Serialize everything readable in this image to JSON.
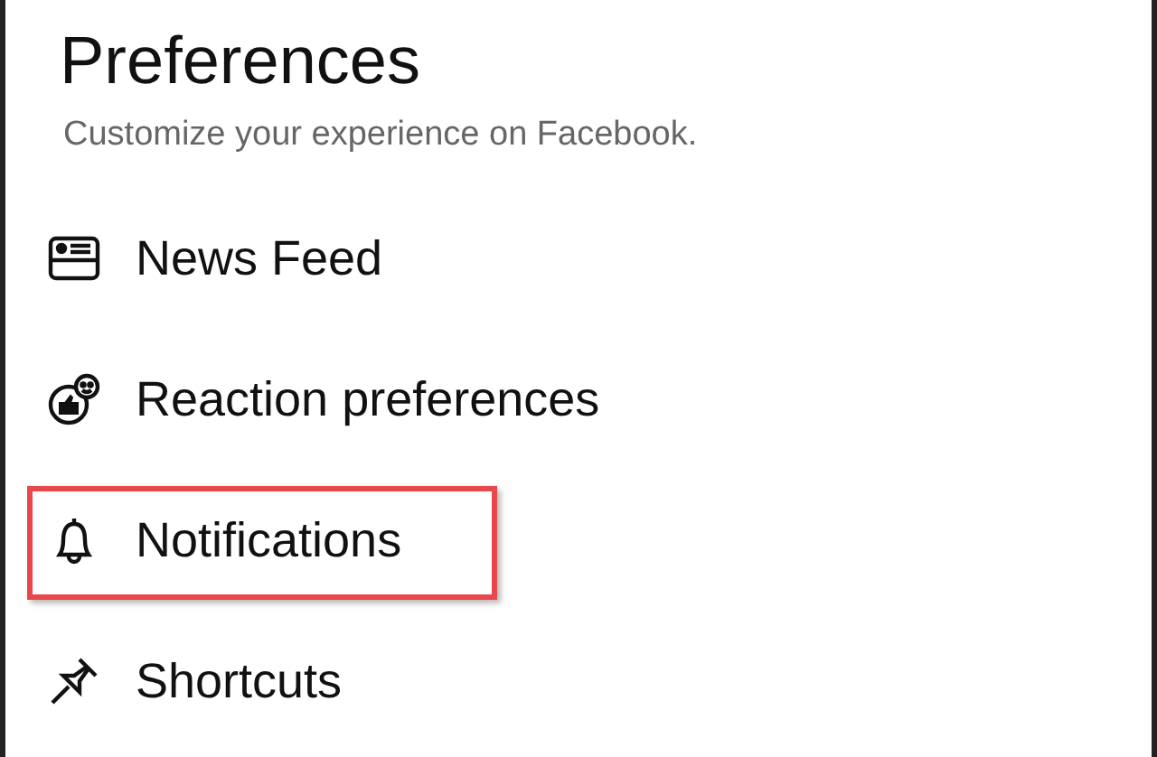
{
  "header": {
    "title": "Preferences",
    "subtitle": "Customize your experience on Facebook."
  },
  "items": [
    {
      "label": "News Feed",
      "kind": "feed",
      "highlighted": false
    },
    {
      "label": "Reaction preferences",
      "kind": "reaction",
      "highlighted": false
    },
    {
      "label": "Notifications",
      "kind": "bell",
      "highlighted": true
    },
    {
      "label": "Shortcuts",
      "kind": "pin",
      "highlighted": false
    }
  ]
}
